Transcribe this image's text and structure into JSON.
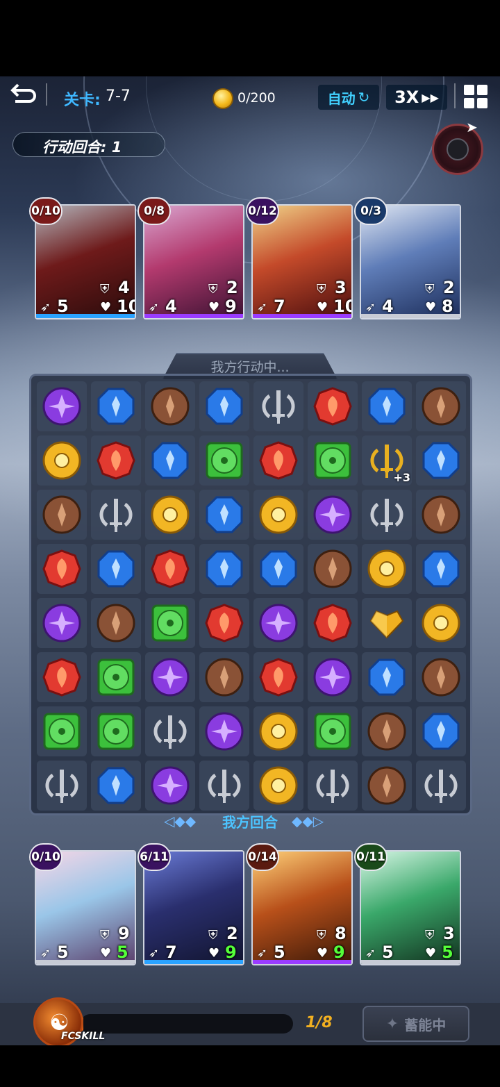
{
  "header": {
    "level_label": "关卡:",
    "level_value": "7-7",
    "coins": "0/200",
    "auto_label": "自动",
    "speed_label": "3X",
    "turn_text": "行动回合: 1"
  },
  "enemies": [
    {
      "energy": "0/10",
      "energy_color": "#7a1a1a",
      "bar_color": "#2aa3ff",
      "armor": "4",
      "attack": "5",
      "hp": "10"
    },
    {
      "energy": "0/8",
      "energy_color": "#7a1a1a",
      "bar_color": "#9a3cff",
      "armor": "2",
      "attack": "4",
      "hp": "9"
    },
    {
      "energy": "0/12",
      "energy_color": "#3a1260",
      "bar_color": "#9a3cff",
      "armor": "3",
      "attack": "7",
      "hp": "10"
    },
    {
      "energy": "0/3",
      "energy_color": "#1a3a6a",
      "bar_color": "#c8ccd6",
      "armor": "2",
      "attack": "4",
      "hp": "8"
    }
  ],
  "board": {
    "status": "我方行动中...",
    "turn_label": "我方回合",
    "rows": [
      [
        "purple",
        "blue",
        "brown",
        "blue",
        "sword",
        "red",
        "blue",
        "brown"
      ],
      [
        "yellow",
        "red",
        "blue",
        "green",
        "red",
        "green",
        "gold-sword",
        "blue"
      ],
      [
        "brown",
        "sword",
        "yellow",
        "blue",
        "yellow",
        "purple",
        "sword",
        "brown"
      ],
      [
        "red",
        "blue",
        "red",
        "blue",
        "blue",
        "brown",
        "yellow",
        "blue"
      ],
      [
        "purple",
        "brown",
        "green",
        "red",
        "purple",
        "red",
        "heart",
        "yellow"
      ],
      [
        "red",
        "green",
        "purple",
        "brown",
        "red",
        "purple",
        "blue",
        "brown"
      ],
      [
        "green",
        "green",
        "sword",
        "purple",
        "yellow",
        "green",
        "brown",
        "blue"
      ],
      [
        "sword",
        "blue",
        "purple",
        "sword",
        "yellow",
        "sword",
        "brown",
        "sword"
      ]
    ],
    "gold_sword_badge": "+3"
  },
  "heroes": [
    {
      "energy": "0/10",
      "energy_color": "#3a1260",
      "bar_color": "#c8ccd6",
      "armor": "9",
      "attack": "5",
      "hp": "5"
    },
    {
      "energy": "6/11",
      "energy_color": "#3a1260",
      "bar_color": "#2aa3ff",
      "armor": "2",
      "attack": "7",
      "hp": "9"
    },
    {
      "energy": "0/14",
      "energy_color": "#5a1a10",
      "bar_color": "#9a3cff",
      "armor": "8",
      "attack": "5",
      "hp": "9"
    },
    {
      "energy": "0/11",
      "energy_color": "#1a4a1a",
      "bar_color": "#c8ccd6",
      "armor": "3",
      "attack": "5",
      "hp": "5"
    }
  ],
  "skill": {
    "label": "FCSKILL",
    "progress_text": "1/8",
    "progress_fraction": 0.125,
    "charge_label": "蓄能中"
  },
  "gem_colors": {
    "purple": "#8a3ce0",
    "blue": "#2a7ae8",
    "brown": "#8a5236",
    "red": "#e23a30",
    "yellow": "#f2b624",
    "green": "#3cc03c",
    "sword": "#c8ccd4",
    "gold-sword": "#e8b020",
    "heart": "#f0b020"
  }
}
